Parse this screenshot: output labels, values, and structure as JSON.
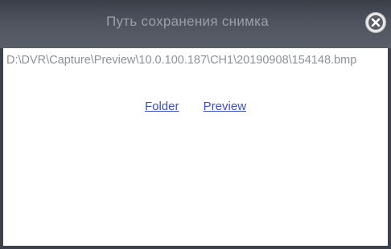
{
  "dialog": {
    "title": "Путь сохранения снимка",
    "close_icon": "close-icon",
    "path": "D:\\DVR\\Capture\\Preview\\10.0.100.187\\CH1\\20190908\\154148.bmp",
    "links": {
      "folder_label": "Folder",
      "preview_label": "Preview"
    },
    "colors": {
      "titlebar": "#4e535e",
      "title_text": "#9aa0ab",
      "link": "#3b4fc4",
      "path_text": "#8c9099"
    }
  }
}
